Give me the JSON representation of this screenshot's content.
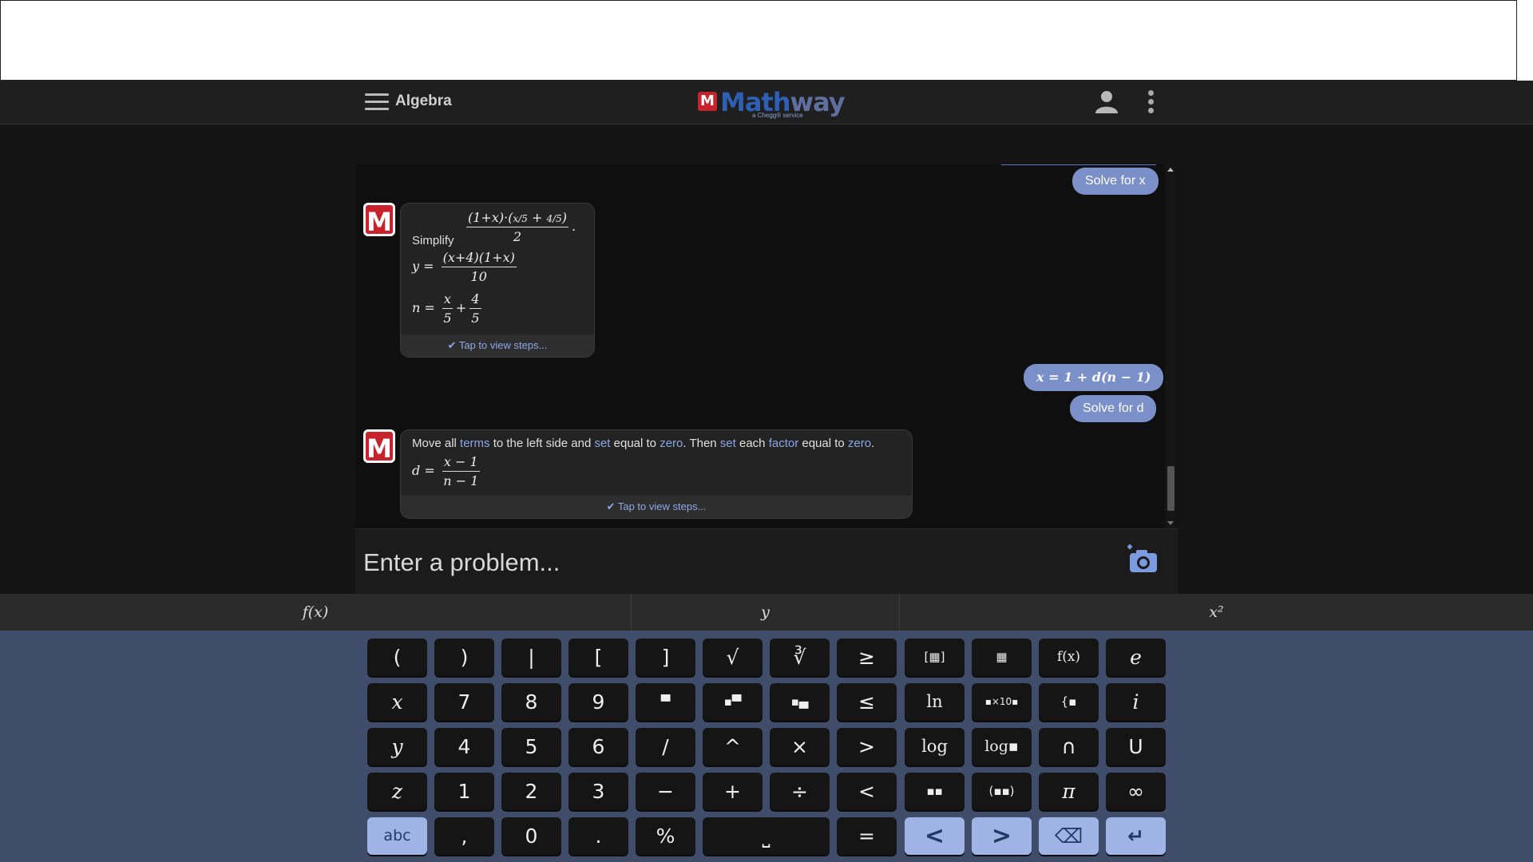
{
  "header": {
    "subject": "Algebra",
    "logo_mark": "M",
    "logo_text_a": "Math",
    "logo_text_b": "way",
    "logo_sub": "a Chegg® service"
  },
  "chat": {
    "messages": [
      {
        "from": "user",
        "text": "Solve for x"
      },
      {
        "from": "bot",
        "intro": "Simplify",
        "expr": "(1+x)·(x/5 + 4/5) / 2",
        "lines": [
          "y = (x+4)(1+x) / 10",
          "n = x/5 + 4/5"
        ],
        "footer": "Tap to view steps..."
      },
      {
        "from": "user",
        "text": "x = 1 + d(n − 1)"
      },
      {
        "from": "user",
        "text": "Solve for d"
      },
      {
        "from": "bot",
        "intro": "Move all terms to the left side and set equal to zero. Then set each factor equal to zero.",
        "answer": "d = (x−1)/(n−1)",
        "footer": "Tap to view steps..."
      }
    ]
  },
  "input": {
    "placeholder": "Enter a problem..."
  },
  "keyboard": {
    "tabs": [
      "f(x)",
      "y",
      "x²"
    ],
    "rows": [
      [
        "(",
        ")",
        "|",
        "[",
        "]",
        "√",
        "∛",
        "≥",
        "[▦]",
        "▦",
        "f(x)",
        "e"
      ],
      [
        "x",
        "7",
        "8",
        "9",
        "▀",
        "▪▀",
        "▪▄",
        "≤",
        "ln",
        "▪×10▪",
        "{▪",
        "i"
      ],
      [
        "y",
        "4",
        "5",
        "6",
        "/",
        "^",
        "×",
        ">",
        "log",
        "log▪",
        "∩",
        "U"
      ],
      [
        "z",
        "1",
        "2",
        "3",
        "−",
        "+",
        "÷",
        "<",
        "▪▪",
        "(▪▪)",
        "π",
        "∞"
      ],
      [
        "abc",
        ",",
        "0",
        ".",
        "%",
        "⎵",
        "=",
        "<",
        ">",
        "⌫",
        "↵"
      ]
    ]
  },
  "colors": {
    "accent": "#7b8fc9",
    "keyboard_bg": "#3f4d6b",
    "brand_red": "#c8232c"
  }
}
